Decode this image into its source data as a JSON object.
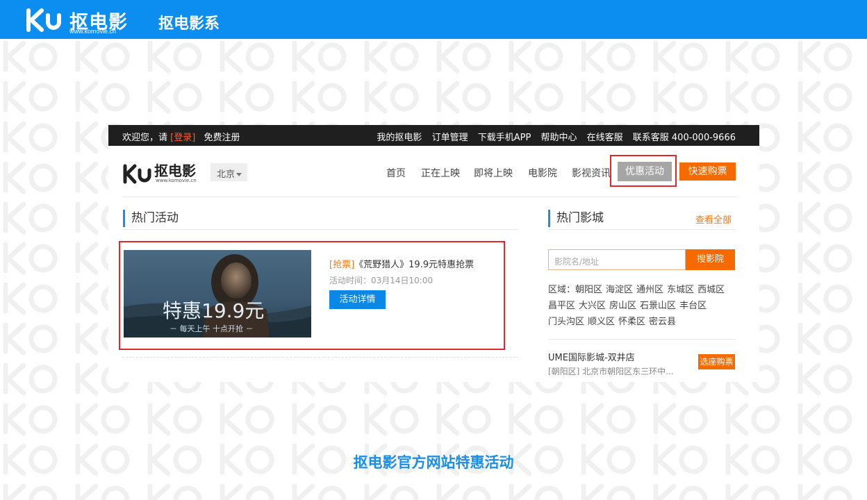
{
  "banner": {
    "logo_brand": "抠电影",
    "logo_url": "www.komovie.cn",
    "title": "抠电影系"
  },
  "topbar": {
    "welcome": "欢迎您，请",
    "login": "[登录]",
    "register": "免费注册",
    "links": [
      "我的抠电影",
      "订单管理",
      "下载手机APP",
      "帮助中心",
      "在线客服"
    ],
    "hotline": "联系客服 400-000-9666"
  },
  "nav": {
    "logo_brand": "抠电影",
    "logo_url": "www.komovie.cn",
    "city": "北京",
    "menu": [
      "首页",
      "正在上映",
      "即将上映",
      "电影院",
      "影视资讯"
    ],
    "promo": "优惠活动",
    "buy": "快速购票"
  },
  "hot_events": {
    "title": "热门活动",
    "event": {
      "tag": "[抢票]",
      "name": "《荒野猎人》19.9元特惠抢票",
      "time": "活动时间：03月14日10:00",
      "image_price": "特惠19.9元",
      "image_sub": "－ 每天上午  十点开抢 －",
      "detail_button": "活动详情"
    }
  },
  "hot_cinemas": {
    "title": "热门影城",
    "more": "查看全部",
    "search_placeholder": "影院名/地址",
    "search_button": "搜影院",
    "district_label": "区域：",
    "districts": [
      "朝阳区",
      "海淀区",
      "通州区",
      "东城区",
      "西城区",
      "昌平区",
      "大兴区",
      "房山区",
      "石景山区",
      "丰台区",
      "门头沟区",
      "顺义区",
      "怀柔区",
      "密云县"
    ],
    "cinema": {
      "name": "UME国际影城-双井店",
      "address": "[朝阳区] 北京市朝阳区东三环中...",
      "button": "选座购票"
    }
  },
  "caption": "抠电影官方网站特惠活动",
  "colors": {
    "banner_blue": "#0b8ef0",
    "orange": "#f76a00",
    "highlight_red": "#e0272c",
    "promo_gray": "#a6a6a6"
  }
}
